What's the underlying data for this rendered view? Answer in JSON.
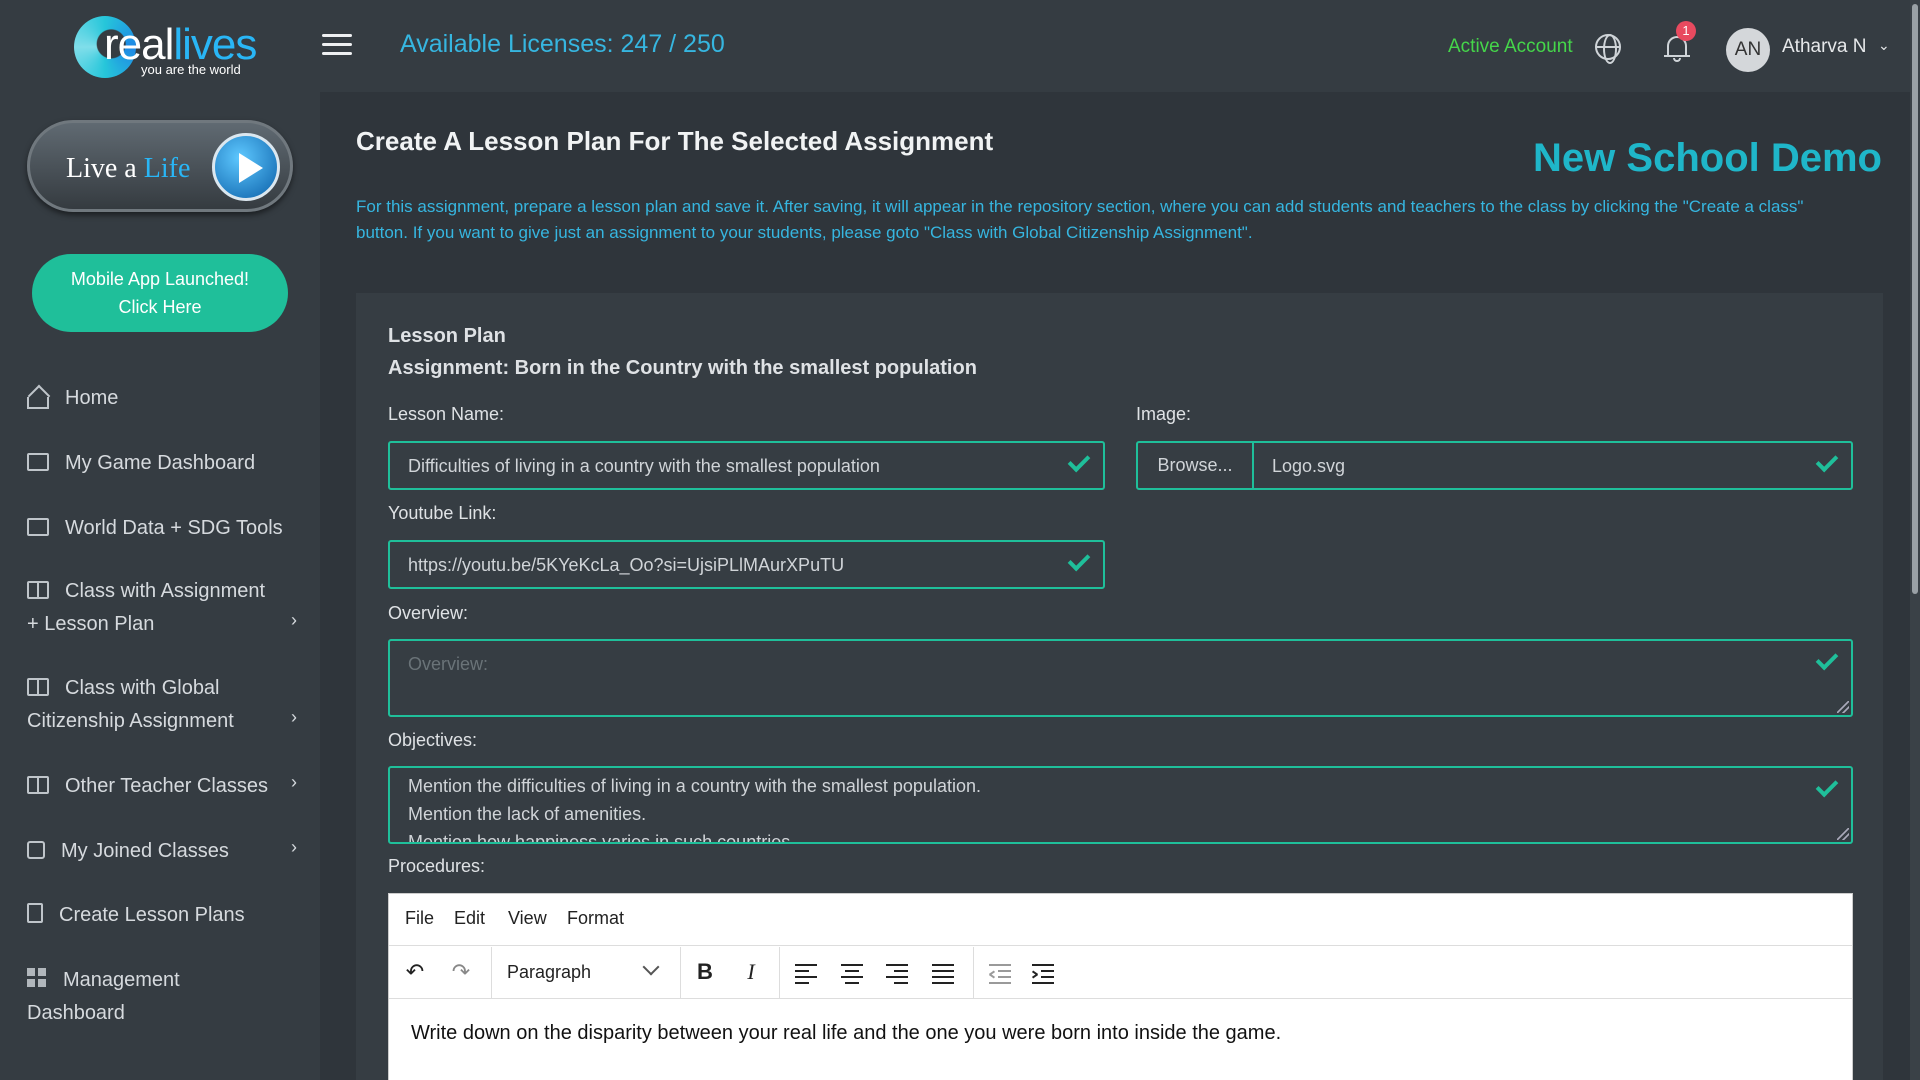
{
  "logo": {
    "word_main": "real",
    "word_accent": "lives",
    "tagline": "you are the world"
  },
  "live_button": {
    "text_main": "Live a ",
    "text_accent": "Life"
  },
  "mobile_button": {
    "line1": "Mobile App Launched!",
    "line2": "Click Here"
  },
  "sidebar": {
    "items": [
      {
        "label": "Home",
        "icon": "home-icon"
      },
      {
        "label": "My Game Dashboard",
        "icon": "monitor-icon"
      },
      {
        "label": "World Data + SDG Tools",
        "icon": "monitor-icon"
      },
      {
        "label": "Class with Assignment",
        "label2": "+ Lesson Plan",
        "icon": "book-icon",
        "has_chevron": true
      },
      {
        "label": "Class with Global",
        "label2": "Citizenship Assignment",
        "icon": "book-icon",
        "has_chevron": true
      },
      {
        "label": "Other Teacher Classes",
        "icon": "book-icon",
        "has_chevron": true
      },
      {
        "label": "My Joined Classes",
        "icon": "thumbs-up-icon",
        "has_chevron": true
      },
      {
        "label": "Create Lesson Plans",
        "icon": "tablet-icon"
      },
      {
        "label": "Management",
        "label2": "Dashboard",
        "icon": "grid-icon"
      }
    ],
    "chevron": "›"
  },
  "header": {
    "licenses": "Available Licenses: 247 / 250",
    "active_account": "Active Account",
    "notification_count": "1",
    "avatar_initials": "AN",
    "user_name": "Atharva N",
    "user_chevron": "⌄"
  },
  "main": {
    "title": "Create A Lesson Plan For The Selected Assignment",
    "school_name": "New School Demo",
    "intro": "For this assignment, prepare a lesson plan and save it. After saving, it will appear in the repository section, where you can add students and teachers to the class by clicking the \"Create a class\" button. If you want to give just an assignment to your students, please goto \"Class with Global Citizenship Assignment\"."
  },
  "form": {
    "card_title": "Lesson Plan",
    "assignment": "Assignment: Born in the Country with the smallest population",
    "lesson_name_label": "Lesson Name:",
    "lesson_name_value": "Difficulties of living in a country with the smallest population",
    "image_label": "Image:",
    "browse_label": "Browse...",
    "image_file": "Logo.svg",
    "youtube_label": "Youtube Link:",
    "youtube_value": "https://youtu.be/5KYeKcLa_Oo?si=UjsiPLlMAurXPuTU",
    "overview_label": "Overview:",
    "overview_placeholder": "Overview:",
    "objectives_label": "Objectives:",
    "objectives_lines": [
      "Mention the difficulties of living in a country with the smallest population.",
      "Mention the lack of amenities.",
      "Mention how happiness varies in such countries."
    ],
    "procedures_label": "Procedures:"
  },
  "editor": {
    "menu": [
      "File",
      "Edit",
      "View",
      "Format"
    ],
    "block_format": "Paragraph",
    "bold": "B",
    "italic": "I",
    "undo": "↶",
    "redo": "↷",
    "content": "Write down on the disparity between your real life and the one you were born into inside the game."
  },
  "colors": {
    "accent_teal": "#1fbf9a",
    "link_blue": "#36b6e0",
    "school_name": "#1fb6c9",
    "active_green": "#45d64a",
    "badge_red": "#e84a5f"
  }
}
